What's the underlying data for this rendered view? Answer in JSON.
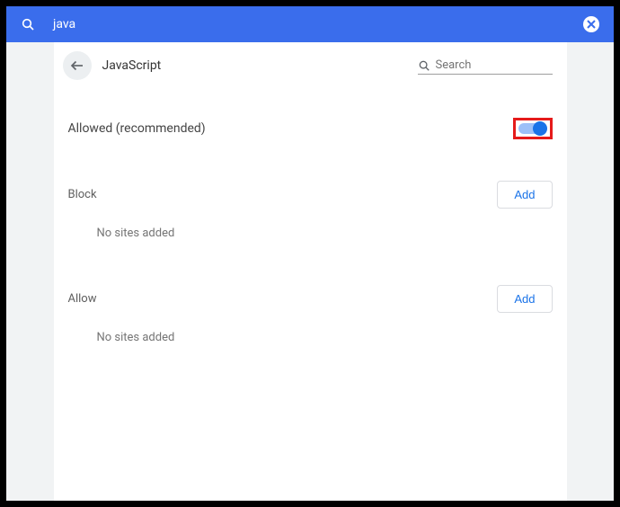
{
  "topbar": {
    "search_query": "java"
  },
  "header": {
    "title": "JavaScript",
    "search_placeholder": "Search"
  },
  "allowed_row": {
    "label": "Allowed (recommended)",
    "toggle_on": true
  },
  "block_section": {
    "title": "Block",
    "add_label": "Add",
    "empty_text": "No sites added"
  },
  "allow_section": {
    "title": "Allow",
    "add_label": "Add",
    "empty_text": "No sites added"
  }
}
